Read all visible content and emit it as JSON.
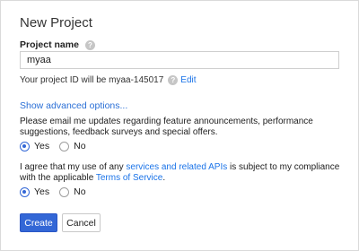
{
  "dialog": {
    "title": "New Project"
  },
  "project_name": {
    "label": "Project name",
    "value": "myaa"
  },
  "project_id": {
    "prefix": "Your project ID will be myaa-145017",
    "edit_label": "Edit"
  },
  "advanced_options_label": "Show advanced options...",
  "email_question": {
    "text": "Please email me updates regarding feature announcements, performance suggestions, feedback surveys and special offers.",
    "options": [
      "Yes",
      "No"
    ],
    "selected": "Yes"
  },
  "terms_question": {
    "text_before": "I agree that my use of any ",
    "link1": "services and related APIs",
    "text_middle": " is subject to my compliance with the applicable ",
    "link2": "Terms of Service",
    "text_after": ".",
    "options": [
      "Yes",
      "No"
    ],
    "selected": "Yes"
  },
  "buttons": {
    "create": "Create",
    "cancel": "Cancel"
  },
  "colors": {
    "primary": "#3367d6",
    "link": "#1a73e8"
  },
  "icons": {
    "help": "help-circle-icon"
  }
}
